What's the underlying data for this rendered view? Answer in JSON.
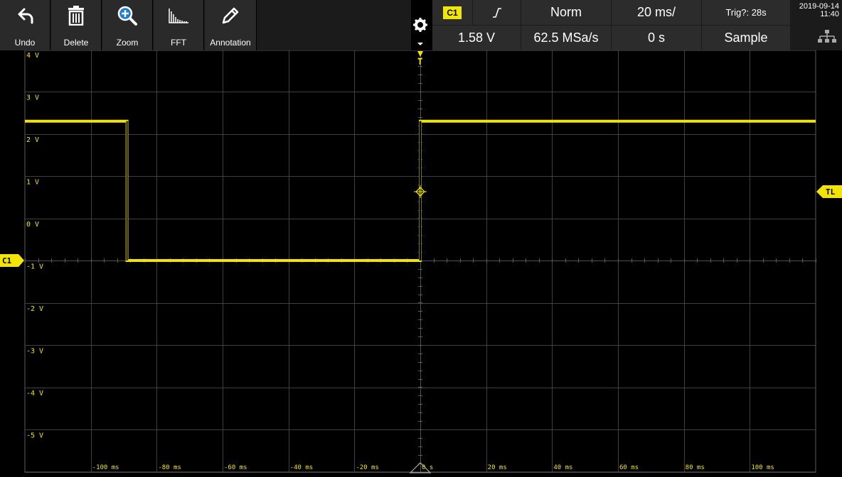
{
  "toolbar": {
    "buttons": [
      {
        "label": "Undo",
        "icon": "undo-icon"
      },
      {
        "label": "Delete",
        "icon": "trash-icon"
      },
      {
        "label": "Zoom",
        "icon": "zoom-icon"
      },
      {
        "label": "FFT",
        "icon": "fft-icon"
      },
      {
        "label": "Annotation",
        "icon": "pencil-icon"
      }
    ],
    "settings_icon": "gear-icon"
  },
  "trigger_panel": {
    "channel": "C1",
    "slope_icon": "rising-edge-icon",
    "mode": "Norm",
    "timebase": "20 ms/",
    "trig_status": "Trig?: 28s",
    "date": "2019-09-14",
    "time": "11:40",
    "trigger_level": "1.58 V",
    "sample_rate": "62.5 MSa/s",
    "horizontal_position": "0 s",
    "acquisition": "Sample",
    "network_icon": "network-icon"
  },
  "markers": {
    "channel_marker": "C1",
    "trigger_level_marker": "TL",
    "trigger_position_marker": "T"
  },
  "chart_data": {
    "type": "line",
    "colors": {
      "trace": "#f2e600",
      "grid": "#5a5a5a",
      "labels": "#f2e600"
    },
    "y_tick_labels": [
      "4 V",
      "3 V",
      "2 V",
      "1 V",
      "0 V",
      "-1 V",
      "-2 V",
      "-3 V",
      "-4 V",
      "-5 V"
    ],
    "x_tick_labels": [
      "-100 ms",
      "-80 ms",
      "-60 ms",
      "-40 ms",
      "-20 ms",
      "0 s",
      "20 ms",
      "40 ms",
      "60 ms",
      "80 ms",
      "100 ms"
    ],
    "xlim_ms": [
      -120,
      120
    ],
    "ylim_v": [
      -5,
      5
    ],
    "trigger_level_v": 1.58,
    "series": [
      {
        "x_ms": [
          -120,
          -89,
          -89,
          0,
          0,
          120
        ],
        "y_v": [
          3.3,
          3.3,
          0.0,
          0.0,
          3.3,
          3.3
        ]
      }
    ]
  }
}
